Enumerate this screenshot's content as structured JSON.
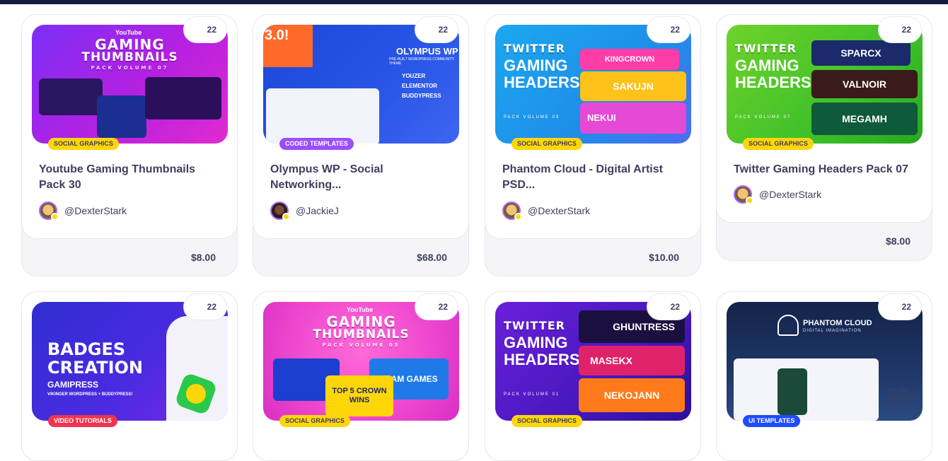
{
  "products": [
    {
      "title": "Youtube Gaming Thumbnails Pack 30",
      "category": "Social Graphics",
      "author": "@DexterStark",
      "price": "$8.00",
      "badge": "22",
      "thumb": {
        "line1": "GAMING",
        "line2": "THUMBNAILS",
        "sub": "PACK VOLUME 07",
        "tag": "YouTube"
      }
    },
    {
      "title": "Olympus WP - Social Networking...",
      "category": "Coded Templates",
      "author": "@JackieJ",
      "price": "$68.00",
      "badge": "22",
      "thumb": {
        "line1": "OLYMPUS WP",
        "line2": "3.0!",
        "sub": "PRE-BUILT WORDPRESS COMMUNITY THEME",
        "features": [
          "YOUZER",
          "ELEMENTOR",
          "BUDDYPRESS"
        ]
      }
    },
    {
      "title": "Phantom Cloud - Digital Artist PSD...",
      "category": "Social Graphics",
      "author": "@DexterStark",
      "price": "$10.00",
      "badge": "22",
      "thumb": {
        "line1": "TWITTER",
        "line2": "GAMING HEADERS",
        "sub": "PACK VOLUME 03",
        "names": [
          "KINGCROWN",
          "SAKUJN",
          "NEKUI"
        ]
      }
    },
    {
      "title": "Twitter Gaming Headers Pack 07",
      "category": "Social Graphics",
      "author": "@DexterStark",
      "price": "$8.00",
      "badge": "22",
      "thumb": {
        "line1": "TWITTER",
        "line2": "GAMING HEADERS",
        "sub": "PACK VOLUME 07",
        "names": [
          "SPARCX",
          "VALNOIR",
          "MEGAMH"
        ]
      }
    },
    {
      "title": "",
      "category": "Video Tutorials",
      "author": "",
      "price": "",
      "badge": "22",
      "thumb": {
        "line1": "BADGES",
        "line2": "CREATION",
        "sub": "GAMIPRESS",
        "extra": "VIKINGER WORDPRESS + BUDDYPRESS!"
      }
    },
    {
      "title": "",
      "category": "Social Graphics",
      "author": "",
      "price": "",
      "badge": "22",
      "thumb": {
        "line1": "GAMING",
        "line2": "THUMBNAILS",
        "sub": "PACK VOLUME 05",
        "tag": "YouTube",
        "names": [
          "TOP 5 CROWN WINS",
          "TEAM GAMES"
        ]
      }
    },
    {
      "title": "",
      "category": "Social Graphics",
      "author": "",
      "price": "",
      "badge": "22",
      "thumb": {
        "line1": "TWITTER",
        "line2": "GAMING HEADERS",
        "sub": "PACK VOLUME 01",
        "names": [
          "GHUNTRESS",
          "MASEKX",
          "NEKOJANN"
        ]
      }
    },
    {
      "title": "",
      "category": "UI Templates",
      "author": "",
      "price": "",
      "badge": "22",
      "thumb": {
        "line1": "PHANTOM CLOUD",
        "sub": "DIGITAL IMAGINATION",
        "extra": "HI! I'M JESSICA VALEN"
      }
    }
  ],
  "colors": {
    "yellow": "#ffd60a",
    "purple": "#9b4dff",
    "red": "#f0344e",
    "blue": "#1d4cff",
    "text": "#3e3f5e"
  }
}
